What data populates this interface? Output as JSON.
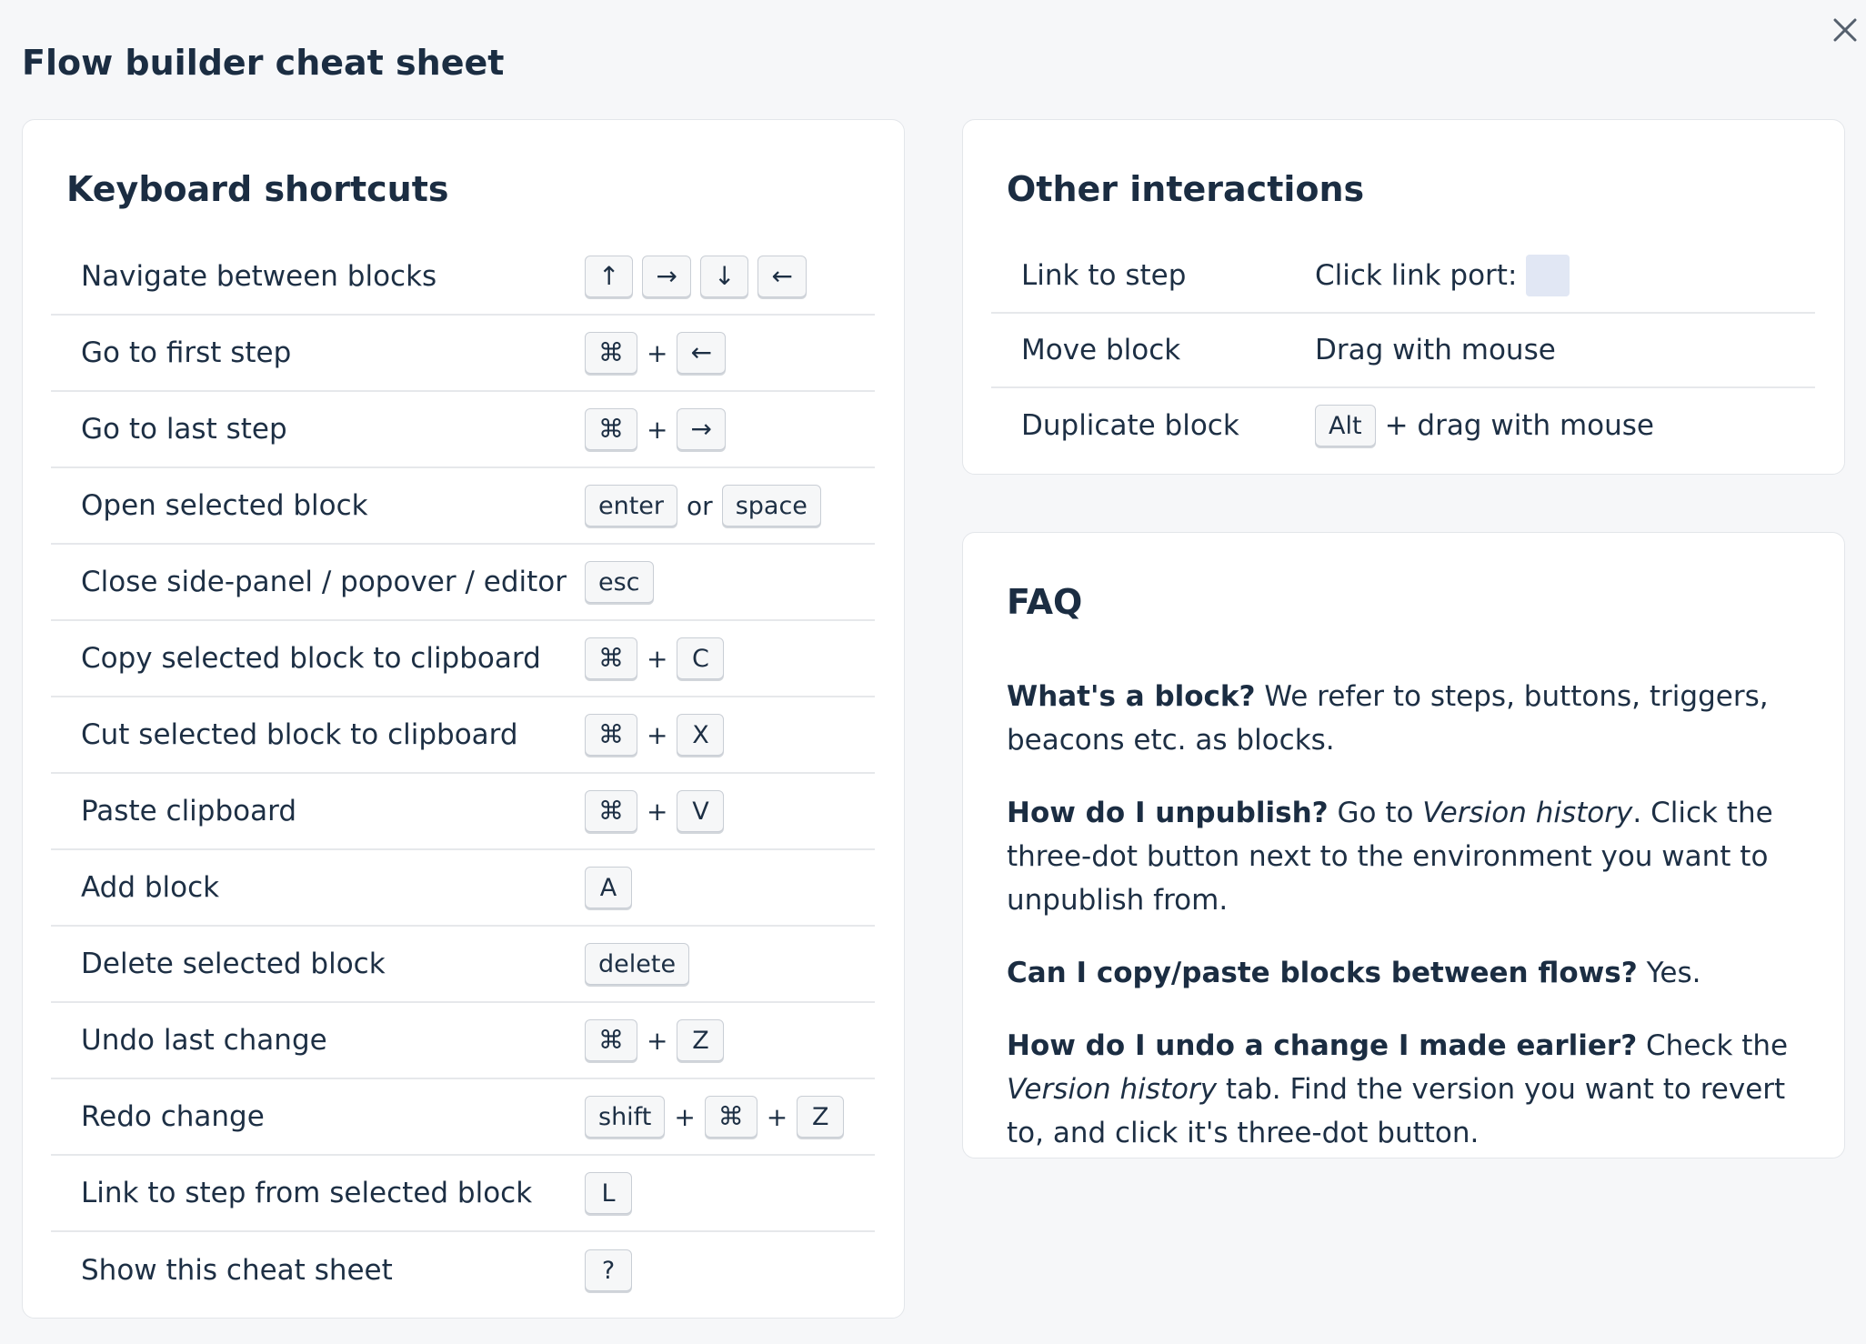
{
  "page": {
    "title": "Flow builder cheat sheet"
  },
  "keyboard": {
    "heading": "Keyboard shortcuts",
    "rows": [
      {
        "action": "Navigate between blocks",
        "keys": [
          {
            "k": "↑"
          },
          {
            "k": "→"
          },
          {
            "k": "↓"
          },
          {
            "k": "←"
          }
        ]
      },
      {
        "action": "Go to first step",
        "keys": [
          {
            "k": "⌘"
          },
          {
            "sep": "+"
          },
          {
            "k": "←"
          }
        ]
      },
      {
        "action": "Go to last step",
        "keys": [
          {
            "k": "⌘"
          },
          {
            "sep": "+"
          },
          {
            "k": "→"
          }
        ]
      },
      {
        "action": "Open selected block",
        "keys": [
          {
            "k": "enter"
          },
          {
            "sep": "or"
          },
          {
            "k": "space"
          }
        ]
      },
      {
        "action": "Close side-panel / popover / editor",
        "keys": [
          {
            "k": "esc"
          }
        ]
      },
      {
        "action": "Copy selected block to clipboard",
        "keys": [
          {
            "k": "⌘"
          },
          {
            "sep": "+"
          },
          {
            "k": "C"
          }
        ]
      },
      {
        "action": "Cut selected block to clipboard",
        "keys": [
          {
            "k": "⌘"
          },
          {
            "sep": "+"
          },
          {
            "k": "X"
          }
        ]
      },
      {
        "action": "Paste clipboard",
        "keys": [
          {
            "k": "⌘"
          },
          {
            "sep": "+"
          },
          {
            "k": "V"
          }
        ]
      },
      {
        "action": "Add block",
        "keys": [
          {
            "k": "A"
          }
        ]
      },
      {
        "action": "Delete selected block",
        "keys": [
          {
            "k": "delete"
          }
        ]
      },
      {
        "action": "Undo last change",
        "keys": [
          {
            "k": "⌘"
          },
          {
            "sep": "+"
          },
          {
            "k": "Z"
          }
        ]
      },
      {
        "action": "Redo change",
        "keys": [
          {
            "k": "shift"
          },
          {
            "sep": "+"
          },
          {
            "k": "⌘"
          },
          {
            "sep": "+"
          },
          {
            "k": "Z"
          }
        ]
      },
      {
        "action": "Link to step from selected block",
        "keys": [
          {
            "k": "L"
          }
        ]
      },
      {
        "action": "Show this cheat sheet",
        "keys": [
          {
            "k": "?"
          }
        ]
      }
    ]
  },
  "other": {
    "heading": "Other interactions",
    "link_to_step": {
      "action": "Link to step",
      "detail": "Click link port:"
    },
    "move_block": {
      "action": "Move block",
      "detail": "Drag with mouse"
    },
    "duplicate_block": {
      "action": "Duplicate block",
      "key": "Alt",
      "detail": "+ drag with mouse"
    }
  },
  "faq": {
    "heading": "FAQ",
    "items": [
      {
        "q": "What's a block?",
        "a": " We refer to steps, buttons, triggers, beacons etc. as blocks."
      },
      {
        "q": "How do I unpublish?",
        "a1": " Go to ",
        "em": "Version history",
        "a2": ". Click the three-dot button next to the environment you want to unpublish from."
      },
      {
        "q": "Can I copy/paste blocks between flows?",
        "a": " Yes."
      },
      {
        "q": "How do I undo a change I made earlier?",
        "a1": " Check the ",
        "em": "Version history",
        "a2": " tab. Find the version you want to revert to, and click it's three-dot button."
      }
    ]
  },
  "icons": {
    "close": "close-icon",
    "link_port": "link-port-icon"
  },
  "colors": {
    "background": "#f6f7f9",
    "card": "#ffffff",
    "text": "#1d2f44",
    "link_port": "#e1e7f4"
  }
}
